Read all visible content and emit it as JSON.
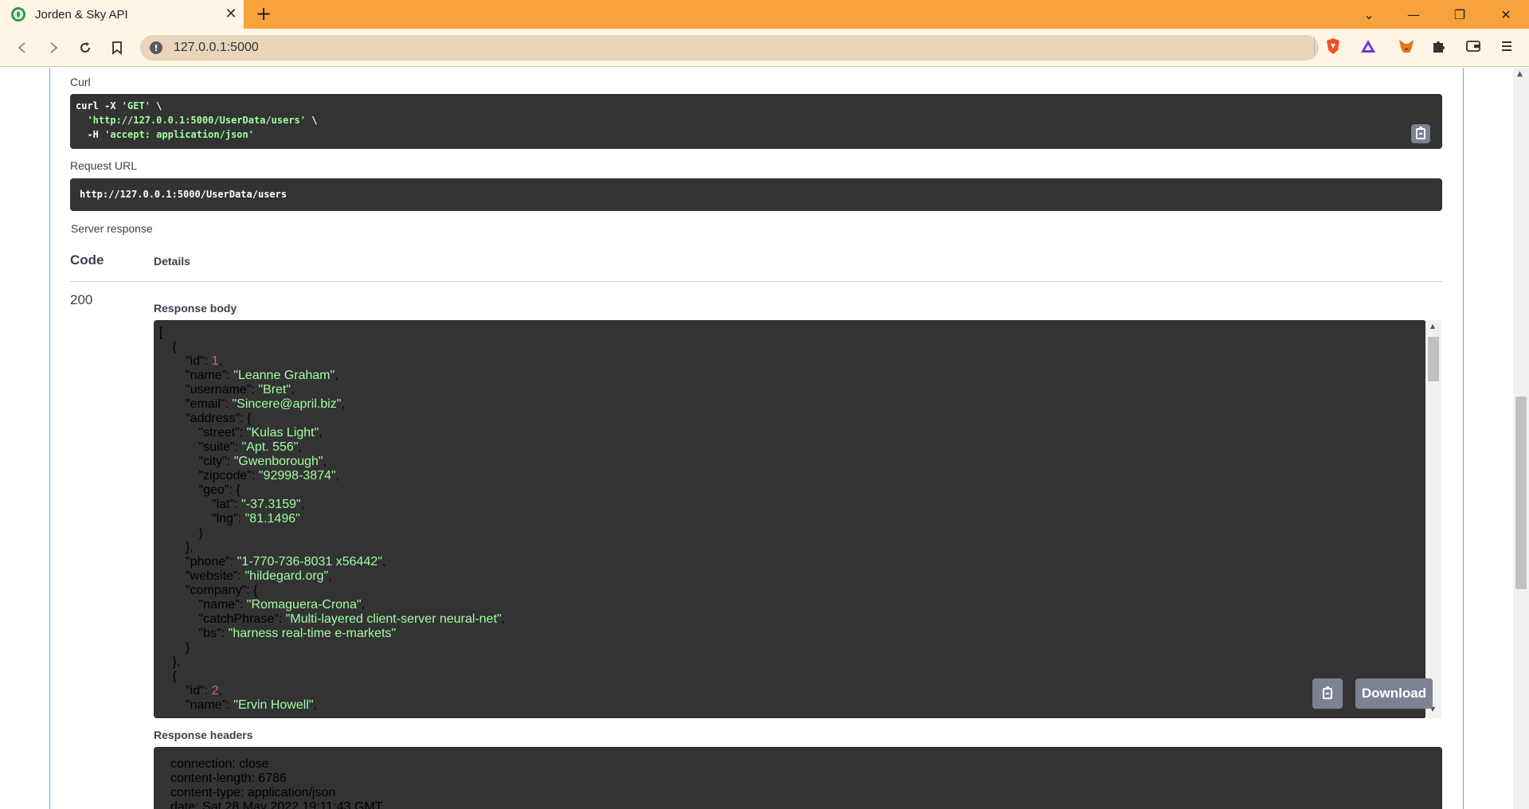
{
  "browser": {
    "tab_title": "Jorden & Sky API",
    "tab_close": "✕",
    "new_tab": "+",
    "url": "127.0.0.1:5000",
    "window_controls": [
      "⌄",
      "—",
      "❐",
      "✕"
    ],
    "icons": [
      "back-icon",
      "forward-icon",
      "reload-icon",
      "bookmark-icon",
      "info-icon",
      "brave-shields-icon",
      "brave-rewards-icon",
      "metamask-icon",
      "extensions-icon",
      "wallet-icon",
      "menu-icon"
    ]
  },
  "request": {
    "curl_label": "Curl",
    "curl_lines": [
      {
        "plain": "curl -X ",
        "str": "'GET'",
        "tail": " \\"
      },
      {
        "plain": "  ",
        "str": "'http://127.0.0.1:5000/UserData/users'",
        "tail": " \\"
      },
      {
        "plain": "  -H ",
        "str": "'accept: application/json'",
        "tail": ""
      }
    ],
    "request_url_label": "Request URL",
    "request_url": "http://127.0.0.1:5000/UserData/users"
  },
  "response": {
    "server_response_label": "Server response",
    "code_header": "Code",
    "details_header": "Details",
    "status_code": "200",
    "body_label": "Response body",
    "body_lines": [
      {
        "indent": 0,
        "key": "",
        "value": "[",
        "type": "punct",
        "suffix": ""
      },
      {
        "indent": 1,
        "key": "",
        "value": "{",
        "type": "punct",
        "suffix": ""
      },
      {
        "indent": 2,
        "key": "\"id\"",
        "value": "1",
        "type": "num",
        "suffix": ","
      },
      {
        "indent": 2,
        "key": "\"name\"",
        "value": "\"Leanne Graham\"",
        "type": "str",
        "suffix": ","
      },
      {
        "indent": 2,
        "key": "\"username\"",
        "value": "\"Bret\"",
        "type": "str",
        "suffix": ","
      },
      {
        "indent": 2,
        "key": "\"email\"",
        "value": "\"Sincere@april.biz\"",
        "type": "str",
        "suffix": ","
      },
      {
        "indent": 2,
        "key": "\"address\"",
        "value": "{",
        "type": "punct",
        "suffix": ""
      },
      {
        "indent": 3,
        "key": "\"street\"",
        "value": "\"Kulas Light\"",
        "type": "str",
        "suffix": ","
      },
      {
        "indent": 3,
        "key": "\"suite\"",
        "value": "\"Apt. 556\"",
        "type": "str",
        "suffix": ","
      },
      {
        "indent": 3,
        "key": "\"city\"",
        "value": "\"Gwenborough\"",
        "type": "str",
        "suffix": ","
      },
      {
        "indent": 3,
        "key": "\"zipcode\"",
        "value": "\"92998-3874\"",
        "type": "str",
        "suffix": ","
      },
      {
        "indent": 3,
        "key": "\"geo\"",
        "value": "{",
        "type": "punct",
        "suffix": ""
      },
      {
        "indent": 4,
        "key": "\"lat\"",
        "value": "\"-37.3159\"",
        "type": "str",
        "suffix": ","
      },
      {
        "indent": 4,
        "key": "\"lng\"",
        "value": "\"81.1496\"",
        "type": "str",
        "suffix": ""
      },
      {
        "indent": 3,
        "key": "",
        "value": "}",
        "type": "punct",
        "suffix": ""
      },
      {
        "indent": 2,
        "key": "",
        "value": "},",
        "type": "punct",
        "suffix": ""
      },
      {
        "indent": 2,
        "key": "\"phone\"",
        "value": "\"1-770-736-8031 x56442\"",
        "type": "str",
        "suffix": ","
      },
      {
        "indent": 2,
        "key": "\"website\"",
        "value": "\"hildegard.org\"",
        "type": "str",
        "suffix": ","
      },
      {
        "indent": 2,
        "key": "\"company\"",
        "value": "{",
        "type": "punct",
        "suffix": ""
      },
      {
        "indent": 3,
        "key": "\"name\"",
        "value": "\"Romaguera-Crona\"",
        "type": "str",
        "suffix": ","
      },
      {
        "indent": 3,
        "key": "\"catchPhrase\"",
        "value": "\"Multi-layered client-server neural-net\"",
        "type": "str",
        "suffix": ","
      },
      {
        "indent": 3,
        "key": "\"bs\"",
        "value": "\"harness real-time e-markets\"",
        "type": "str",
        "suffix": ""
      },
      {
        "indent": 2,
        "key": "",
        "value": "}",
        "type": "punct",
        "suffix": ""
      },
      {
        "indent": 1,
        "key": "",
        "value": "},",
        "type": "punct",
        "suffix": ""
      },
      {
        "indent": 1,
        "key": "",
        "value": "{",
        "type": "punct",
        "suffix": ""
      },
      {
        "indent": 2,
        "key": "\"id\"",
        "value": "2",
        "type": "num",
        "suffix": ","
      },
      {
        "indent": 2,
        "key": "\"name\"",
        "value": "\"Ervin Howell\"",
        "type": "str",
        "suffix": ","
      }
    ],
    "download_label": "Download",
    "headers_label": "Response headers",
    "headers_lines": [
      "connection: close",
      "content-length: 6786",
      "content-type: application/json",
      "date: Sat,28 May 2022 19:11:43 GMT"
    ]
  }
}
